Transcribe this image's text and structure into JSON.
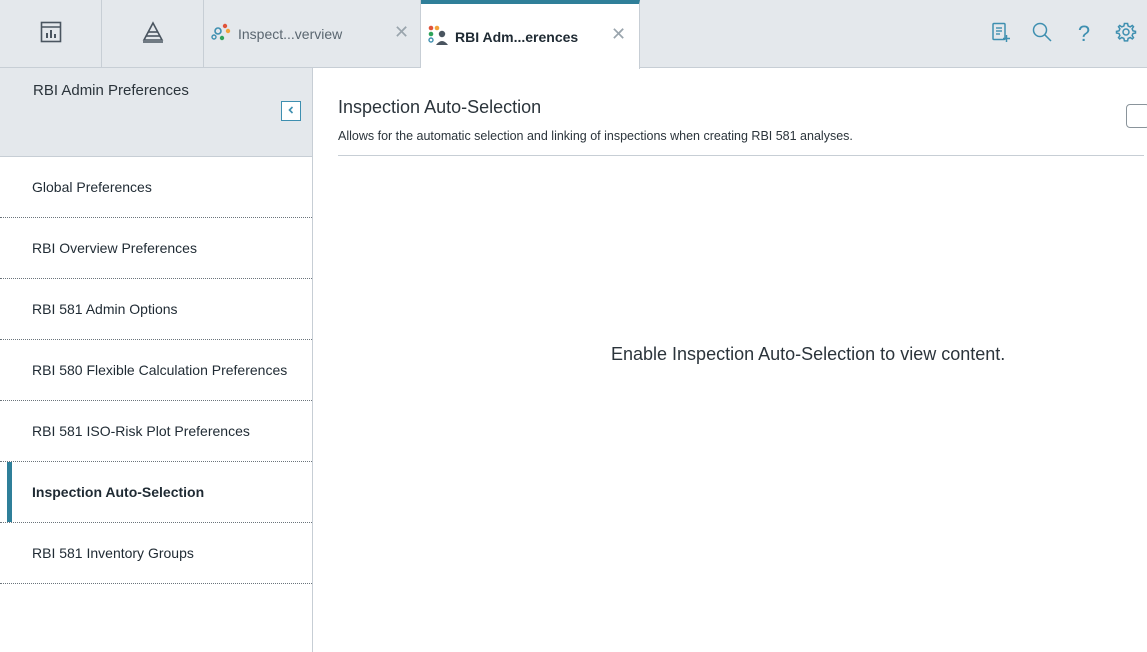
{
  "topbar": {
    "tabs": [
      {
        "label": "Inspect...verview",
        "icon": "inspection-overview-icon",
        "active": false
      },
      {
        "label": "RBI Adm...erences",
        "icon": "rbi-admin-icon",
        "active": true
      }
    ],
    "close_glyph": "✕",
    "tools": [
      "clipboard-add-icon",
      "search-icon",
      "help-icon",
      "gear-icon"
    ],
    "help_glyph": "?"
  },
  "sidebar": {
    "title": "RBI Admin Preferences",
    "items": [
      {
        "label": "Global Preferences",
        "selected": false
      },
      {
        "label": "RBI Overview Preferences",
        "selected": false
      },
      {
        "label": "RBI 581 Admin Options",
        "selected": false
      },
      {
        "label": "RBI 580 Flexible Calculation Preferences",
        "selected": false
      },
      {
        "label": "RBI 581 ISO-Risk Plot Preferences",
        "selected": false
      },
      {
        "label": "Inspection Auto-Selection",
        "selected": true
      },
      {
        "label": "RBI 581 Inventory Groups",
        "selected": false
      }
    ]
  },
  "main": {
    "title": "Inspection Auto-Selection",
    "description": "Allows for the automatic selection and linking of inspections when creating RBI 581 analyses.",
    "enabled": false,
    "empty_message": "Enable Inspection Auto-Selection to view content."
  },
  "colors": {
    "accent": "#2f7f99",
    "icon_blue": "#3e8fb0",
    "header_bg": "#e4e8ec"
  }
}
